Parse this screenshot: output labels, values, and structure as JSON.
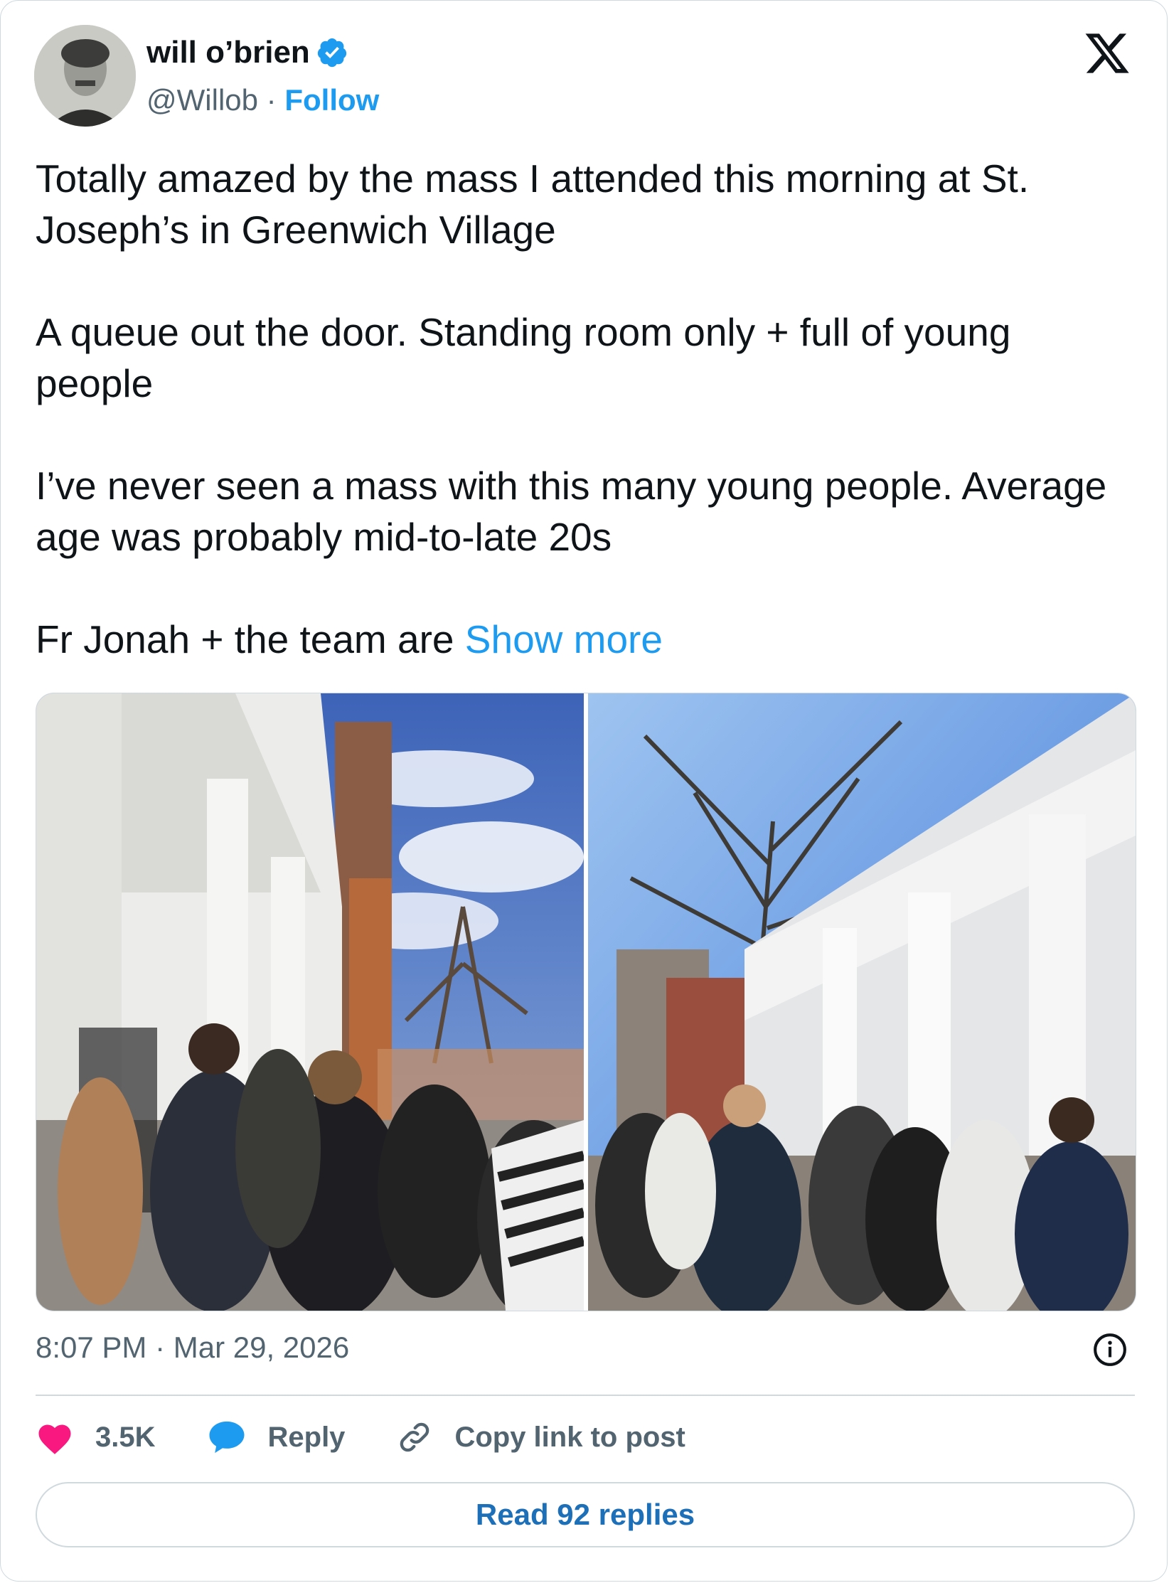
{
  "author": {
    "name": "will o’brien",
    "handle": "@Willob",
    "separator": "·",
    "follow_label": "Follow"
  },
  "post": {
    "paragraphs": [
      "Totally amazed by the mass I attended this morning at St. Joseph’s in Greenwich Village",
      "A queue out the door. Standing room only + full of young people",
      "I’ve never seen a mass with this many young people. Average age was probably mid-to-late 20s"
    ],
    "last_line": "Fr Jonah + the team are",
    "show_more": "Show more",
    "timestamp": "8:07 PM · Mar 29, 2026"
  },
  "actions": {
    "likes": "3.5K",
    "reply": "Reply",
    "copy_link": "Copy link to post"
  },
  "read_replies": "Read 92 replies",
  "icons": {
    "verified": "verified-badge-icon",
    "x_logo": "x-logo-icon",
    "info": "info-icon",
    "like": "heart-icon",
    "reply": "speech-bubble-icon",
    "link": "link-icon"
  },
  "colors": {
    "accent": "#1d9bf0",
    "heart": "#f91880",
    "muted": "#536471"
  }
}
